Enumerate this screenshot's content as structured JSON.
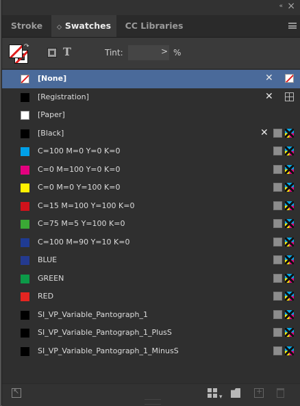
{
  "window": {
    "collapse_label": "«",
    "close_label": "×"
  },
  "tabs": [
    {
      "label": "Stroke",
      "active": false
    },
    {
      "label": "Swatches",
      "active": true,
      "marker": "◇"
    },
    {
      "label": "CC Libraries",
      "active": false
    }
  ],
  "toolbar": {
    "text_mode_label": "T",
    "tint_label": "Tint:",
    "tint_value": "",
    "tint_arrow": ">",
    "tint_unit": "%"
  },
  "swatches": [
    {
      "name": "[None]",
      "color": "none",
      "selected": true,
      "icons": [
        "pencil-crossed",
        "none"
      ]
    },
    {
      "name": "[Registration]",
      "color": "#000000",
      "selected": false,
      "icons": [
        "pencil-crossed",
        "registration"
      ]
    },
    {
      "name": "[Paper]",
      "color": "#ffffff",
      "selected": false,
      "icons": []
    },
    {
      "name": "[Black]",
      "color": "#000000",
      "selected": false,
      "icons": [
        "pencil-crossed",
        "process",
        "cmyk"
      ]
    },
    {
      "name": "C=100 M=0 Y=0 K=0",
      "color": "#00a0e9",
      "selected": false,
      "icons": [
        "process",
        "cmyk"
      ]
    },
    {
      "name": "C=0 M=100 Y=0 K=0",
      "color": "#e4007f",
      "selected": false,
      "icons": [
        "process",
        "cmyk"
      ]
    },
    {
      "name": "C=0 M=0 Y=100 K=0",
      "color": "#fff100",
      "selected": false,
      "icons": [
        "process",
        "cmyk"
      ]
    },
    {
      "name": "C=15 M=100 Y=100 K=0",
      "color": "#d0121b",
      "selected": false,
      "icons": [
        "process",
        "cmyk"
      ]
    },
    {
      "name": "C=75 M=5 Y=100 K=0",
      "color": "#3aa935",
      "selected": false,
      "icons": [
        "process",
        "cmyk"
      ]
    },
    {
      "name": "C=100 M=90 Y=10 K=0",
      "color": "#1f3b93",
      "selected": false,
      "icons": [
        "process",
        "cmyk"
      ]
    },
    {
      "name": "BLUE",
      "color": "#243a8f",
      "selected": false,
      "icons": [
        "process",
        "cmyk"
      ]
    },
    {
      "name": "GREEN",
      "color": "#0c9a48",
      "selected": false,
      "icons": [
        "process",
        "cmyk"
      ]
    },
    {
      "name": "RED",
      "color": "#e52521",
      "selected": false,
      "icons": [
        "process",
        "cmyk"
      ]
    },
    {
      "name": "SI_VP_Variable_Pantograph_1",
      "color": "#000000",
      "selected": false,
      "icons": [
        "process",
        "cmyk"
      ]
    },
    {
      "name": "SI_VP_Variable_Pantograph_1_PlusS",
      "color": "#000000",
      "selected": false,
      "icons": [
        "process",
        "cmyk"
      ]
    },
    {
      "name": "SI_VP_Variable_Pantograph_1_MinusS",
      "color": "#000000",
      "selected": false,
      "icons": [
        "process",
        "cmyk"
      ]
    }
  ],
  "bottombar": {
    "icons": [
      "import-swatches-icon",
      "show-swatch-kinds-icon",
      "new-color-group-icon",
      "new-swatch-icon",
      "delete-swatch-icon"
    ]
  },
  "colors": {
    "panel_bg": "#323232",
    "list_bg": "#2f2f2f",
    "selection": "#4a6a9a",
    "none_slash": "#e01e1e"
  }
}
